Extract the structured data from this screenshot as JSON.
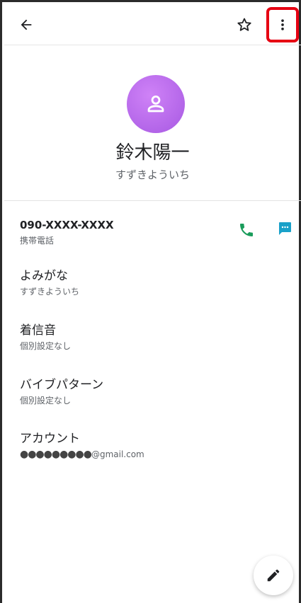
{
  "contact": {
    "name": "鈴木陽一",
    "phonetic": "すずきよういち"
  },
  "rows": [
    {
      "title": "090-XXXX-XXXX",
      "sub": "携帯電話"
    },
    {
      "title": "よみがな",
      "sub": "すずきよういち"
    },
    {
      "title": "着信音",
      "sub": "個別設定なし"
    },
    {
      "title": "バイブパターン",
      "sub": "個別設定なし"
    },
    {
      "title": "アカウント",
      "sub_masked": "●●●●●●●●●",
      "sub_domain": "@gmail.com"
    }
  ],
  "icons": {
    "back": "arrow-left-icon",
    "star": "star-outline-icon",
    "more": "more-vertical-icon",
    "avatar": "person-icon",
    "call": "phone-icon",
    "message": "chat-bubble-icon",
    "edit": "pencil-icon"
  },
  "colors": {
    "avatar": "#b66cf0",
    "call": "#1a9c5b",
    "message": "#1aa1c9",
    "highlight": "#e60012"
  }
}
